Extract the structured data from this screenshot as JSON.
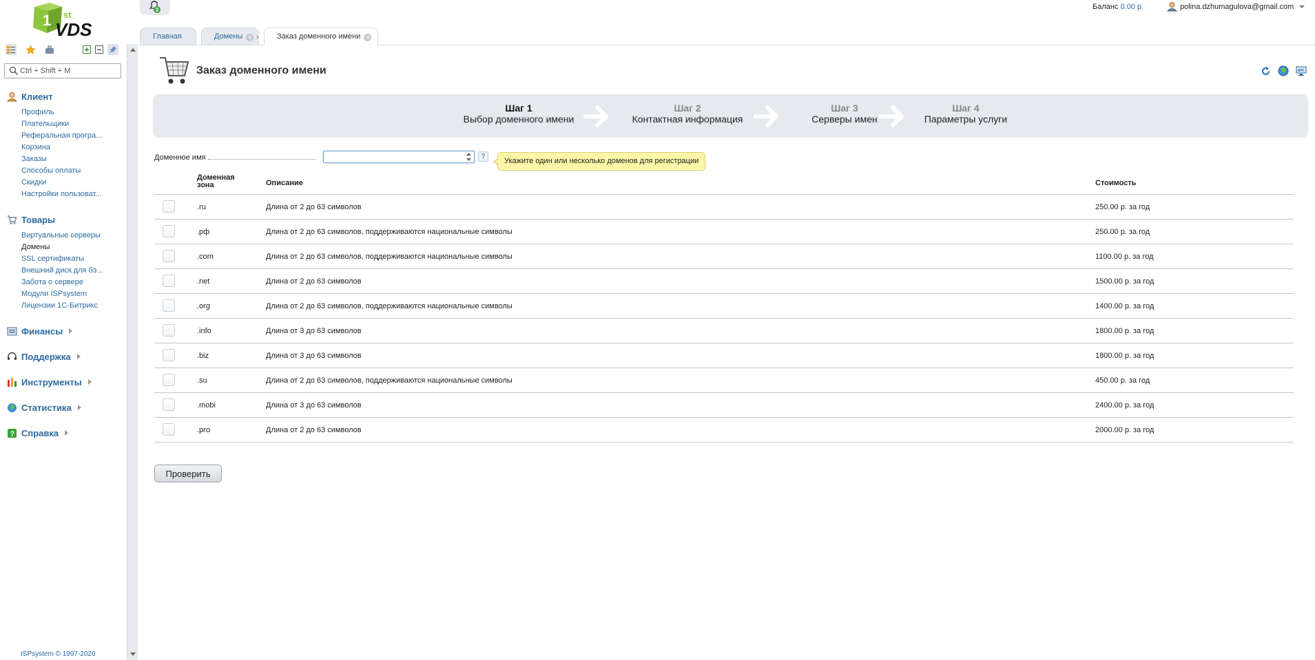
{
  "sidebar": {
    "logo_text": "1st VDS",
    "search_placeholder": "Ctrl + Shift + M",
    "groups": [
      {
        "title": "Клиент",
        "items": [
          "Профиль",
          "Плательщики",
          "Реферальная програ...",
          "Корзина",
          "Заказы",
          "Способы оплаты",
          "Скидки",
          "Настройки пользоват..."
        ]
      },
      {
        "title": "Товары",
        "items": [
          "Виртуальные серверы",
          "Домены",
          "SSL сертификаты",
          "Внешний диск для бэ...",
          "Забота о сервере",
          "Модули ISPsystem",
          "Лицензии 1С-Битрикс"
        ]
      },
      {
        "title": "Финансы"
      },
      {
        "title": "Поддержка"
      },
      {
        "title": "Инструменты"
      },
      {
        "title": "Статистика"
      },
      {
        "title": "Справка"
      }
    ],
    "footer": "ISPsystem © 1997-2020"
  },
  "topbar": {
    "notifications_count": "0",
    "balance_label": "Баланс",
    "balance_value": "0.00 р.",
    "user_email": "polina.dzhumagulova@gmail.com"
  },
  "tabs": [
    {
      "label": "Главная"
    },
    {
      "label": "Домены"
    },
    {
      "label": "Заказ доменного имени"
    }
  ],
  "page": {
    "title": "Заказ доменного имени"
  },
  "steps": [
    {
      "num": "Шаг 1",
      "label": "Выбор доменного имени"
    },
    {
      "num": "Шаг 2",
      "label": "Контактная информация"
    },
    {
      "num": "Шаг 3",
      "label": "Серверы имен"
    },
    {
      "num": "Шаг 4",
      "label": "Параметры услуги"
    }
  ],
  "form": {
    "domain_label": "Доменное имя",
    "domain_value": "",
    "help_symbol": "?",
    "hint": "Укажите один или несколько доменов для регистрации"
  },
  "table": {
    "col_zone_line1": "Доменная",
    "col_zone_line2": "зона",
    "col_desc": "Описание",
    "col_price": "Стоимость",
    "rows": [
      {
        "zone": ".ru",
        "desc": "Длина от 2 до 63 символов",
        "price": "250.00 р. за год"
      },
      {
        "zone": ".рф",
        "desc": "Длина от 2 до 63 символов, поддерживаются национальные символы",
        "price": "250.00 р. за год"
      },
      {
        "zone": ".com",
        "desc": "Длина от 2 до 63 символов, поддерживаются национальные символы",
        "price": "1100.00 р. за год"
      },
      {
        "zone": ".net",
        "desc": "Длина от 2 до 63 символов",
        "price": "1500.00 р. за год"
      },
      {
        "zone": ".org",
        "desc": "Длина от 2 до 63 символов, поддерживаются национальные символы",
        "price": "1400.00 р. за год"
      },
      {
        "zone": ".info",
        "desc": "Длина от 3 до 63 символов",
        "price": "1800.00 р. за год"
      },
      {
        "zone": ".biz",
        "desc": "Длина от 3 до 63 символов",
        "price": "1800.00 р. за год"
      },
      {
        "zone": ".su",
        "desc": "Длина от 2 до 63 символов, поддерживаются национальные символы",
        "price": "450.00 р. за год"
      },
      {
        "zone": ".mobi",
        "desc": "Длина от 3 до 63 символов",
        "price": "2400.00 р. за год"
      },
      {
        "zone": ".pro",
        "desc": "Длина от 2 до 63 символов",
        "price": "2000.00 р. за год"
      }
    ]
  },
  "buttons": {
    "check": "Проверить"
  },
  "colors": {
    "accent": "#2c6aa0",
    "panel": "#e6e9ee",
    "logo_green": "#8cc63f",
    "hint_bg": "#fdf6a8"
  }
}
